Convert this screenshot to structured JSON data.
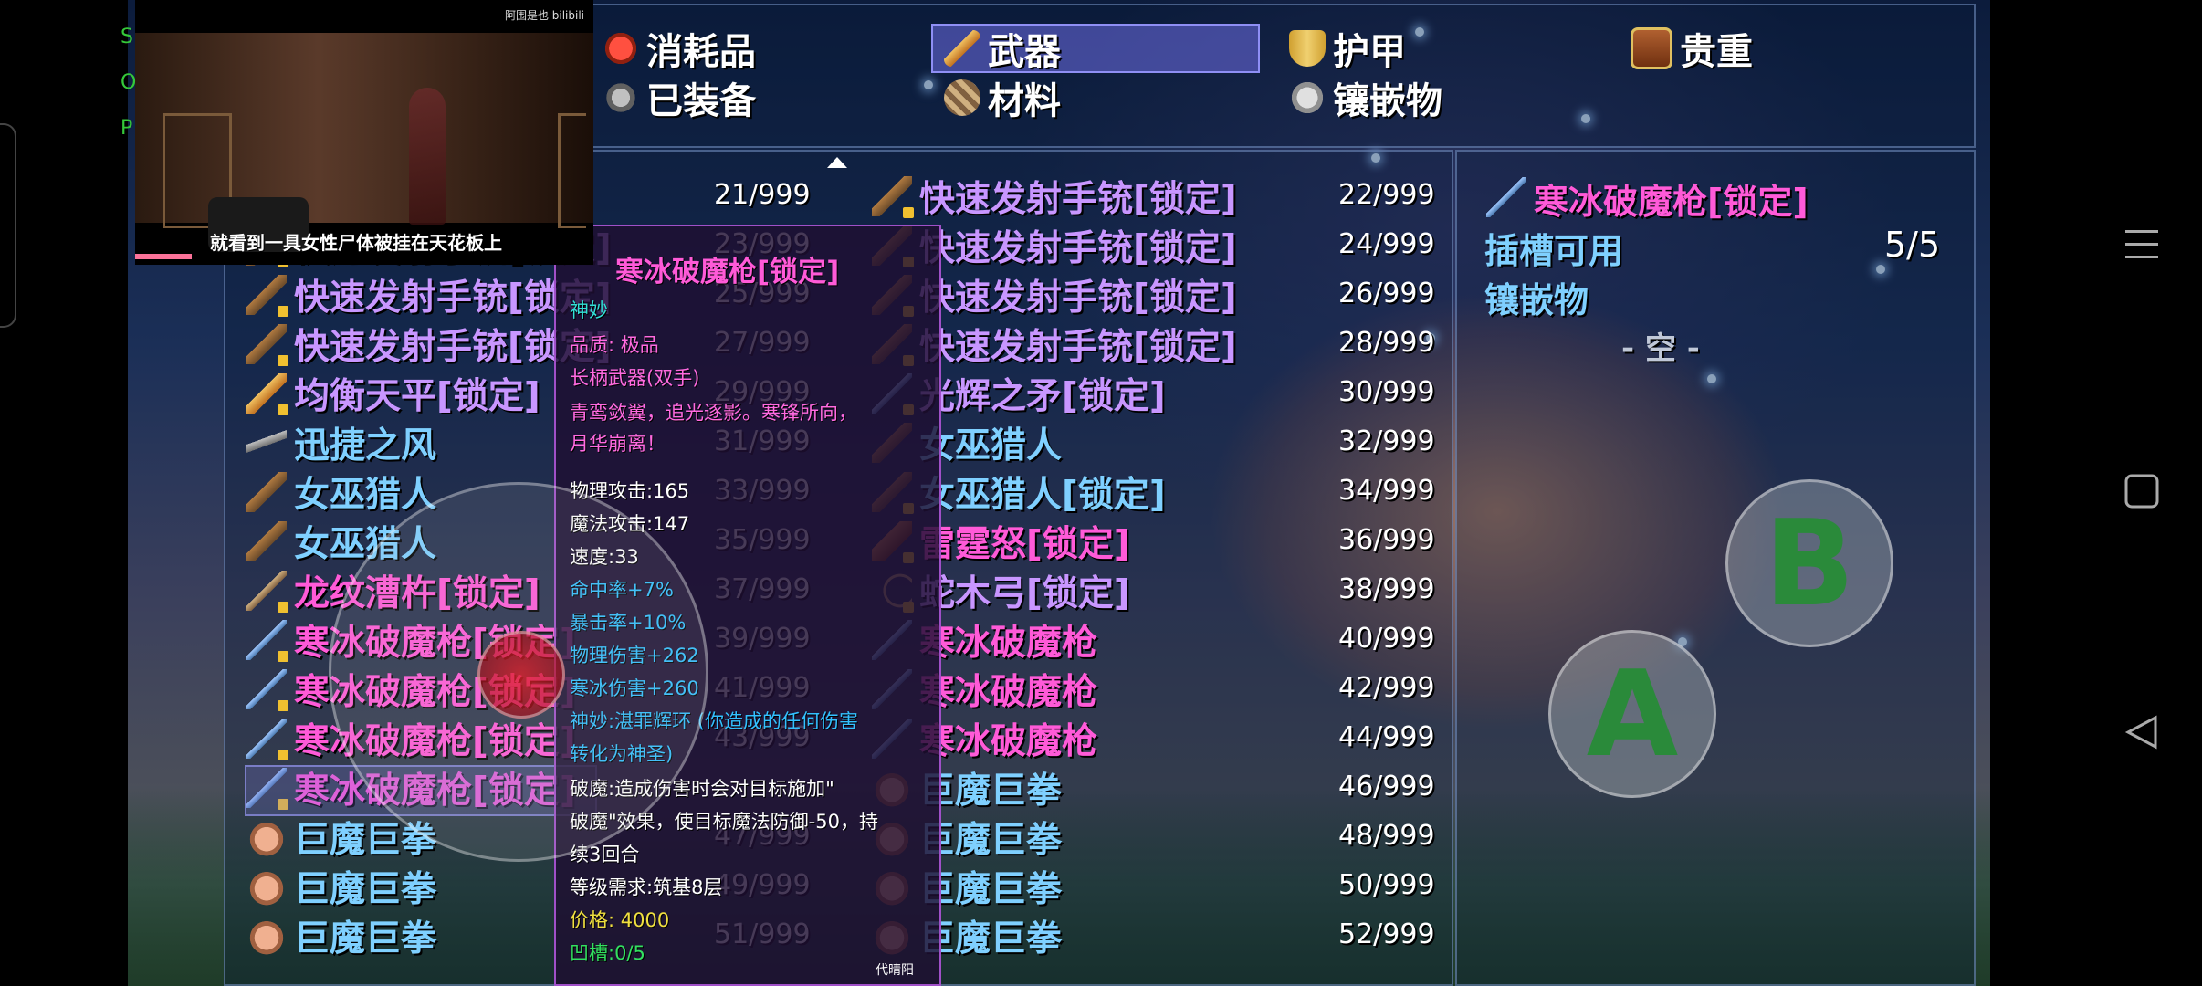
{
  "video": {
    "watermark": "阿围是也 bilibili",
    "subtitle": "就看到一具女性尸体被挂在天花板上"
  },
  "side_letters": [
    "S",
    "O",
    "P"
  ],
  "tabs": [
    {
      "label": "消耗品",
      "icon": "potion-icon"
    },
    {
      "label": "武器",
      "icon": "sword-icon",
      "active": true
    },
    {
      "label": "护甲",
      "icon": "shield-icon"
    },
    {
      "label": "贵重",
      "icon": "chest-icon"
    },
    {
      "label": "已装备",
      "icon": "equipped-icon"
    },
    {
      "label": "材料",
      "icon": "material-icon"
    },
    {
      "label": "镶嵌物",
      "icon": "gem-icon"
    }
  ],
  "left_items": [
    {
      "name": "",
      "count": "21/999"
    },
    {
      "name": "快速发射手铳[锁定]",
      "count": "23/999",
      "color": "purple",
      "icon": "gun"
    },
    {
      "name": "快速发射手铳[锁定]",
      "count": "25/999",
      "color": "purple",
      "icon": "gun"
    },
    {
      "name": "快速发射手铳[锁定]",
      "count": "27/999",
      "color": "purple",
      "icon": "gun"
    },
    {
      "name": "均衡天平[锁定]",
      "count": "29/999",
      "color": "purple",
      "icon": "sword"
    },
    {
      "name": "迅捷之风",
      "count": "31/999",
      "color": "blue",
      "icon": "cross"
    },
    {
      "name": "女巫猎人",
      "count": "33/999",
      "color": "blue",
      "icon": "gun"
    },
    {
      "name": "女巫猎人",
      "count": "35/999",
      "color": "blue",
      "icon": "gun"
    },
    {
      "name": "龙纹漕杵[锁定]",
      "count": "37/999",
      "color": "pink",
      "icon": "pole"
    },
    {
      "name": "寒冰破魔枪[锁定]",
      "count": "39/999",
      "color": "pink",
      "icon": "spear"
    },
    {
      "name": "寒冰破魔枪[锁定]",
      "count": "41/999",
      "color": "pink",
      "icon": "spear"
    },
    {
      "name": "寒冰破魔枪[锁定]",
      "count": "43/999",
      "color": "pink",
      "icon": "spear"
    },
    {
      "name": "寒冰破魔枪[锁定]",
      "count": "",
      "color": "pink",
      "icon": "spear",
      "selected": true
    },
    {
      "name": "巨魔巨拳",
      "count": "47/999",
      "color": "blue",
      "icon": "fist"
    },
    {
      "name": "巨魔巨拳",
      "count": "49/999",
      "color": "blue",
      "icon": "fist"
    },
    {
      "name": "巨魔巨拳",
      "count": "51/999",
      "color": "blue",
      "icon": "fist"
    }
  ],
  "right_items": [
    {
      "name": "快速发射手铳[锁定]",
      "count": "22/999",
      "color": "purple",
      "icon": "gun"
    },
    {
      "name": "快速发射手铳[锁定]",
      "count": "24/999",
      "color": "purple",
      "icon": "gun"
    },
    {
      "name": "快速发射手铳[锁定]",
      "count": "26/999",
      "color": "purple",
      "icon": "gun"
    },
    {
      "name": "快速发射手铳[锁定]",
      "count": "28/999",
      "color": "purple",
      "icon": "gun"
    },
    {
      "name": "光辉之矛[锁定]",
      "count": "30/999",
      "color": "purple",
      "icon": "spear"
    },
    {
      "name": "女巫猎人",
      "count": "32/999",
      "color": "blue",
      "icon": "gun"
    },
    {
      "name": "女巫猎人[锁定]",
      "count": "34/999",
      "color": "blue",
      "icon": "gun"
    },
    {
      "name": "雷霆怒[锁定]",
      "count": "36/999",
      "color": "pink",
      "icon": "club"
    },
    {
      "name": "蛇木弓[锁定]",
      "count": "38/999",
      "color": "purple",
      "icon": "bow"
    },
    {
      "name": "寒冰破魔枪",
      "count": "40/999",
      "color": "pink",
      "icon": "spear"
    },
    {
      "name": "寒冰破魔枪",
      "count": "42/999",
      "color": "pink",
      "icon": "spear"
    },
    {
      "name": "寒冰破魔枪",
      "count": "44/999",
      "color": "pink",
      "icon": "spear"
    },
    {
      "name": "巨魔巨拳",
      "count": "46/999",
      "color": "blue",
      "icon": "fist"
    },
    {
      "name": "巨魔巨拳",
      "count": "48/999",
      "color": "blue",
      "icon": "fist"
    },
    {
      "name": "巨魔巨拳",
      "count": "50/999",
      "color": "blue",
      "icon": "fist"
    },
    {
      "name": "巨魔巨拳",
      "count": "52/999",
      "color": "blue",
      "icon": "fist"
    }
  ],
  "tooltip": {
    "title": "寒冰破魔枪[锁定]",
    "lines": [
      {
        "text": "神妙",
        "color": "#33e0d8"
      },
      {
        "text": "品质: 极品",
        "color": "#ff6ae0"
      },
      {
        "text": "长柄武器(双手)",
        "color": "#ff6ae0"
      },
      {
        "text": "青鸾敛翼，追光逐影。寒锋所向，",
        "color": "#ff6ae0"
      },
      {
        "text": "月华崩离！",
        "color": "#ff6ae0"
      },
      {
        "text": "物理攻击:165",
        "color": "#ffffff"
      },
      {
        "text": "魔法攻击:147",
        "color": "#ffffff"
      },
      {
        "text": "速度:33",
        "color": "#ffffff"
      },
      {
        "text": "命中率+7%",
        "color": "#33c0ff"
      },
      {
        "text": "暴击率+10%",
        "color": "#33c0ff"
      },
      {
        "text": "物理伤害+262",
        "color": "#33c0ff"
      },
      {
        "text": "寒冰伤害+260",
        "color": "#33c0ff"
      },
      {
        "text": "神妙:湛罪辉环 (你造成的任何伤害",
        "color": "#33c0ff"
      },
      {
        "text": "转化为神圣)",
        "color": "#33c0ff"
      },
      {
        "text": "破魔:造成伤害时会对目标施加\"",
        "color": "#ffffff"
      },
      {
        "text": "破魔\"效果，使目标魔法防御-50，持",
        "color": "#ffffff"
      },
      {
        "text": "续3回合",
        "color": "#ffffff"
      },
      {
        "text": "等级需求:筑基8层",
        "color": "#ffffff"
      },
      {
        "text": "价格:  4000",
        "color": "#f0e040"
      },
      {
        "text": "凹槽:0/5",
        "color": "#33e060"
      }
    ],
    "footer": "代晴阳"
  },
  "detail": {
    "title": "寒冰破魔枪[锁定]",
    "slots_label": "插槽可用",
    "slots_value": "5/5",
    "inlay_label": "镶嵌物",
    "empty_label": "- 空 -"
  },
  "buttons": {
    "a": "A",
    "b": "B"
  }
}
